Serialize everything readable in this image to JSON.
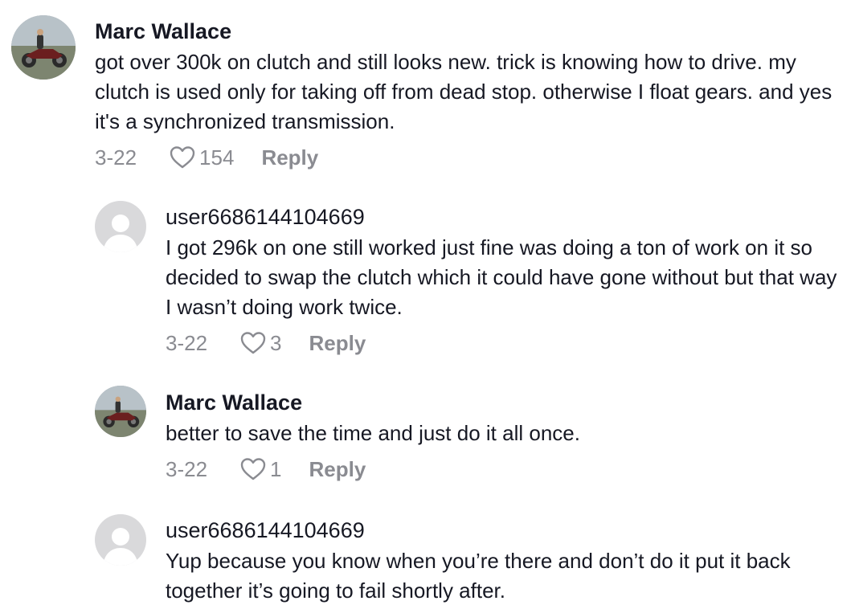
{
  "comments": [
    {
      "username": "Marc Wallace",
      "text": "got over 300k on clutch and still looks new. trick is knowing how to drive. my clutch is used only for taking off from dead stop. otherwise I float gears. and yes it's a synchronized transmission.",
      "date": "3-22",
      "likes": "154",
      "reply_label": "Reply",
      "avatar": "motorcycle-avatar"
    },
    {
      "username": "user6686144104669",
      "text": "I got 296k on one still worked just fine was doing a ton of work on it so decided to swap the clutch which it could have gone without but that way I wasn’t doing work twice.",
      "date": "3-22",
      "likes": "3",
      "reply_label": "Reply",
      "avatar": "default-user-avatar"
    },
    {
      "username": "Marc Wallace",
      "text": "better to save the time and just do it all once.",
      "date": "3-22",
      "likes": "1",
      "reply_label": "Reply",
      "avatar": "motorcycle-avatar"
    },
    {
      "username": "user6686144104669",
      "text": "Yup because you know when you’re there and don’t do it put it back together it’s going to fail shortly after.",
      "avatar": "default-user-avatar"
    }
  ],
  "colors": {
    "text": "#161823",
    "muted": "#8a8b91",
    "avatar_placeholder": "#d9d9db"
  }
}
